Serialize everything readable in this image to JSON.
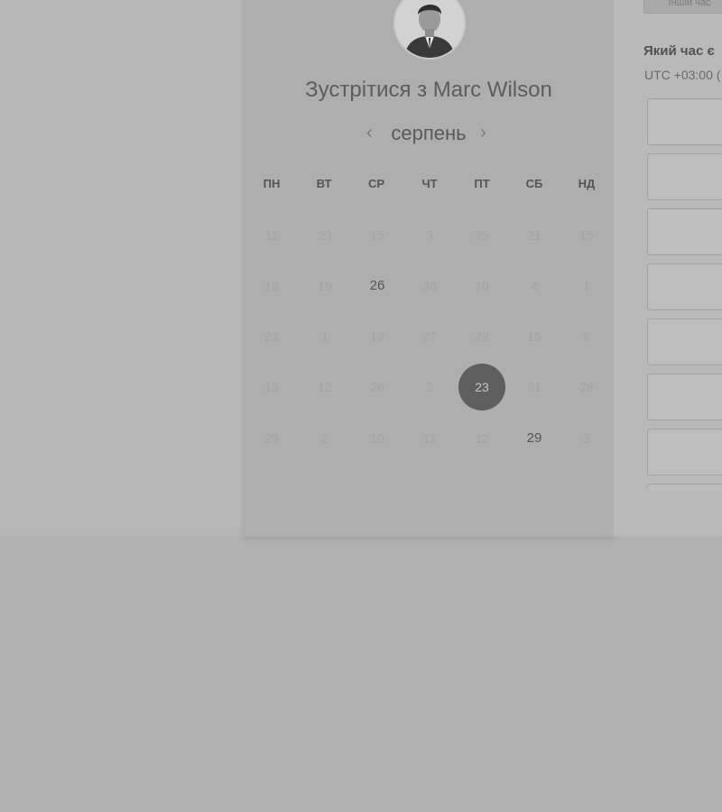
{
  "header": {
    "title": "Зустрітися з Marc Wilson",
    "avatar_icon": "user-portrait"
  },
  "calendar": {
    "month": "серпень",
    "prev_icon": "chevron-left",
    "next_icon": "chevron-right",
    "weekdays": [
      "ПН",
      "ВТ",
      "СР",
      "ЧТ",
      "ПТ",
      "СБ",
      "НД"
    ],
    "weeks": [
      [
        {
          "d": "11"
        },
        {
          "d": "23"
        },
        {
          "d": "15"
        },
        {
          "d": "3"
        },
        {
          "d": "25"
        },
        {
          "d": "21"
        },
        {
          "d": "15"
        }
      ],
      [
        {
          "d": "19"
        },
        {
          "d": "19"
        },
        {
          "d": "26",
          "state": "available"
        },
        {
          "d": "30"
        },
        {
          "d": "10"
        },
        {
          "d": "4"
        },
        {
          "d": "1"
        }
      ],
      [
        {
          "d": "23"
        },
        {
          "d": "1"
        },
        {
          "d": "19"
        },
        {
          "d": "27"
        },
        {
          "d": "28"
        },
        {
          "d": "15"
        },
        {
          "d": "8"
        }
      ],
      [
        {
          "d": "15"
        },
        {
          "d": "12"
        },
        {
          "d": "26"
        },
        {
          "d": "2"
        },
        {
          "d": "23",
          "state": "selected"
        },
        {
          "d": "31"
        },
        {
          "d": "28"
        }
      ],
      [
        {
          "d": "29"
        },
        {
          "d": "2"
        },
        {
          "d": "10"
        },
        {
          "d": "11"
        },
        {
          "d": "12"
        },
        {
          "d": "29",
          "state": "available"
        },
        {
          "d": "3"
        }
      ]
    ]
  },
  "time_panel": {
    "timezone_button": "Іншій час",
    "question": "Який час є",
    "timezone": "UTC +03:00 (",
    "slot_count": 8
  },
  "colors": {
    "overlay_bg": "#b1b1b1",
    "selected_day": "#5f5f5f"
  }
}
